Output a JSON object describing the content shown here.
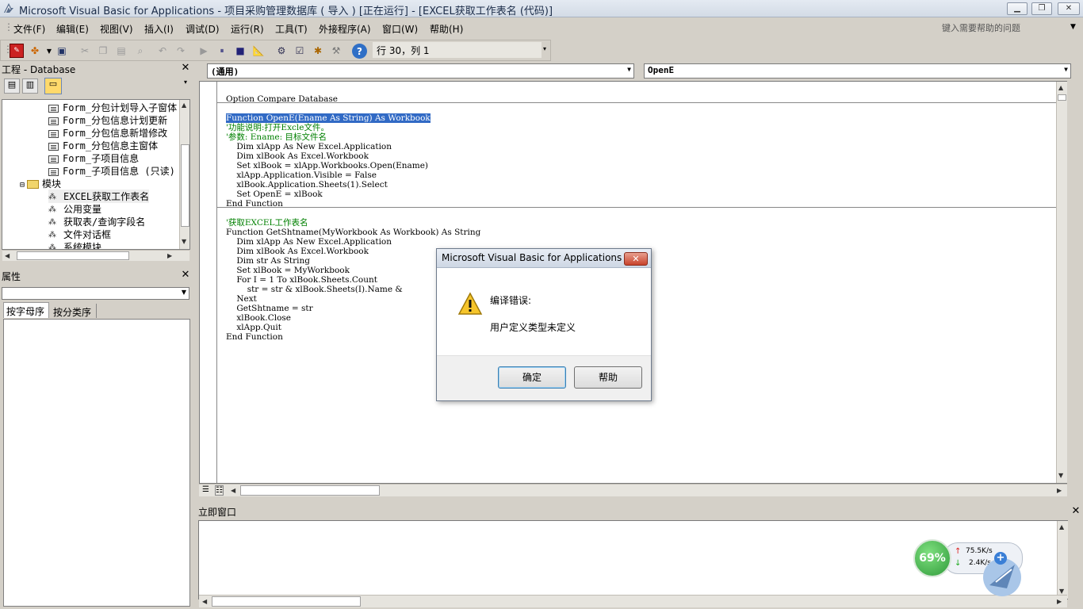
{
  "window": {
    "title": "Microsoft Visual Basic for Applications - 项目采购管理数据库 ( 导入 ) [正在运行] - [EXCEL获取工作表名 (代码)]",
    "minimize_label": "▁",
    "restore_label": "❐",
    "close_label": "✕"
  },
  "menu": {
    "items": [
      "文件(F)",
      "编辑(E)",
      "视图(V)",
      "插入(I)",
      "调试(D)",
      "运行(R)",
      "工具(T)",
      "外接程序(A)",
      "窗口(W)",
      "帮助(H)"
    ],
    "help_placeholder": "键入需要帮助的问题"
  },
  "toolbar": {
    "position_text": "行 30，列 1"
  },
  "project_panel": {
    "title": "工程 - Database",
    "tree": [
      {
        "label": "Form_分包计划导入子窗体",
        "kind": "form"
      },
      {
        "label": "Form_分包信息计划更新",
        "kind": "form"
      },
      {
        "label": "Form_分包信息新增修改",
        "kind": "form"
      },
      {
        "label": "Form_分包信息主窗体",
        "kind": "form"
      },
      {
        "label": "Form_子项目信息",
        "kind": "form"
      },
      {
        "label": "Form_子项目信息 (只读)",
        "kind": "form"
      },
      {
        "label": "模块",
        "kind": "folder",
        "toggle": "⊟"
      },
      {
        "label": "EXCEL获取工作表名",
        "kind": "module"
      },
      {
        "label": "公用变量",
        "kind": "module"
      },
      {
        "label": "获取表/查询字段名",
        "kind": "module"
      },
      {
        "label": "文件对话框",
        "kind": "module"
      },
      {
        "label": "系统模块",
        "kind": "module"
      }
    ]
  },
  "properties_panel": {
    "title": "属性",
    "tabs": [
      "按字母序",
      "按分类序"
    ]
  },
  "code_window": {
    "object_combo": "(通用)",
    "procedure_combo": "OpenE",
    "lines": [
      {
        "text": "Option Compare Database",
        "style": "code"
      },
      {
        "text": "Function OpenE(Ename As String) As Workbook",
        "style": "selected"
      },
      {
        "text": "'功能说明:打开Excle文件。",
        "style": "comment"
      },
      {
        "text": "'参数: Ename: 目标文件名",
        "style": "comment"
      },
      {
        "text": "    Dim xlApp As New Excel.Application",
        "style": "code"
      },
      {
        "text": "    Dim xlBook As Excel.Workbook",
        "style": "code"
      },
      {
        "text": "    Set xlBook = xlApp.Workbooks.Open(Ename)",
        "style": "code"
      },
      {
        "text": "    xlApp.Application.Visible = False",
        "style": "code"
      },
      {
        "text": "    xlBook.Application.Sheets(1).Select",
        "style": "code"
      },
      {
        "text": "    Set OpenE = xlBook",
        "style": "code"
      },
      {
        "text": "End Function",
        "style": "code"
      },
      {
        "text": "'获取EXCEL工作表名",
        "style": "comment"
      },
      {
        "text": "Function GetShtname(MyWorkbook As Workbook) As String",
        "style": "code"
      },
      {
        "text": "    Dim xlApp As New Excel.Application",
        "style": "code"
      },
      {
        "text": "    Dim xlBook As Excel.Workbook",
        "style": "code"
      },
      {
        "text": "    Dim str As String",
        "style": "code"
      },
      {
        "text": "    Set xlBook = MyWorkbook",
        "style": "code"
      },
      {
        "text": "    For I = 1 To xlBook.Sheets.Count",
        "style": "code"
      },
      {
        "text": "        str = str & xlBook.Sheets(I).Name &",
        "style": "code"
      },
      {
        "text": "    Next",
        "style": "code"
      },
      {
        "text": "    GetShtname = str",
        "style": "code"
      },
      {
        "text": "    xlBook.Close",
        "style": "code"
      },
      {
        "text": "    xlApp.Quit",
        "style": "code"
      },
      {
        "text": "End Function",
        "style": "code"
      }
    ]
  },
  "immediate_window": {
    "title": "立即窗口"
  },
  "dialog": {
    "title": "Microsoft Visual Basic for Applications",
    "heading": "编译错误:",
    "message": "用户定义类型未定义",
    "ok_label": "确定",
    "help_label": "帮助"
  },
  "net_widget": {
    "percent": "69%",
    "upload": "75.5K/s",
    "download": "2.4K/s"
  },
  "colors": {
    "selection": "#316ac5",
    "comment": "#008000",
    "chrome": "#d4d0c8"
  }
}
